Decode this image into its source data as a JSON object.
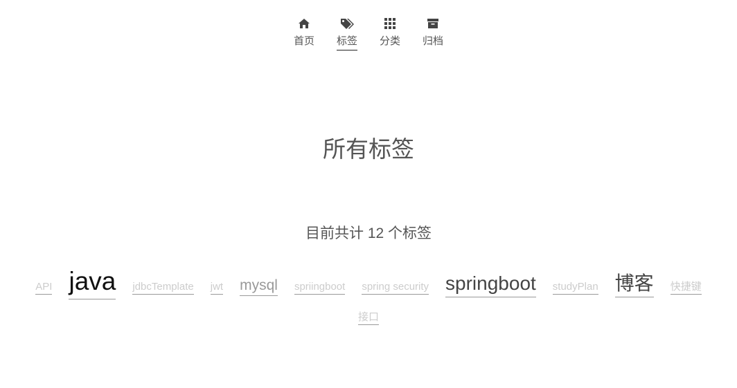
{
  "nav": {
    "items": [
      {
        "label": "首页",
        "icon": "home-icon",
        "active": false
      },
      {
        "label": "标签",
        "icon": "tags-icon",
        "active": true
      },
      {
        "label": "分类",
        "icon": "grid-icon",
        "active": false
      },
      {
        "label": "归档",
        "icon": "archive-icon",
        "active": false
      }
    ]
  },
  "page": {
    "title": "所有标签",
    "count_text": "目前共计 12 个标签"
  },
  "tags": [
    {
      "label": "API",
      "color": "#cccccc"
    },
    {
      "label": "java",
      "color": "#111111"
    },
    {
      "label": "jdbcTemplate",
      "color": "#cccccc"
    },
    {
      "label": "jwt",
      "color": "#cccccc"
    },
    {
      "label": "mysql",
      "color": "#999999"
    },
    {
      "label": "spriingboot",
      "color": "#cccccc"
    },
    {
      "label": "spring security",
      "color": "#cccccc"
    },
    {
      "label": "springboot",
      "color": "#444444"
    },
    {
      "label": "studyPlan",
      "color": "#cccccc"
    },
    {
      "label": "博客",
      "color": "#444444"
    },
    {
      "label": "快捷键",
      "color": "#cccccc"
    },
    {
      "label": "接口",
      "color": "#cccccc"
    }
  ]
}
